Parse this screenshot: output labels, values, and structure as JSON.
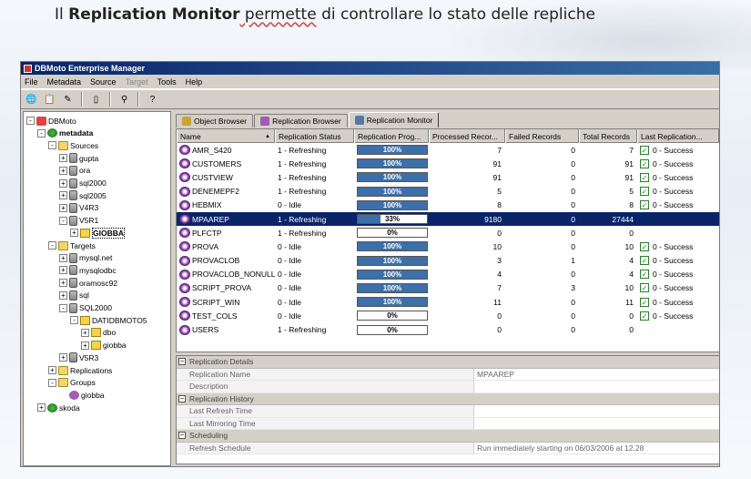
{
  "slide": {
    "prefix": "Il ",
    "bold": "Replication Monitor",
    "middle": " permette",
    "rest": " di controllare lo stato delle repliche"
  },
  "window": {
    "title": "DBMoto Enterprise Manager",
    "menu": [
      "File",
      "Metadata",
      "Source",
      "Target",
      "Tools",
      "Help"
    ]
  },
  "tree": [
    {
      "label": "DBMoto",
      "icon": "dbmoto-icon",
      "level": 0,
      "pm": "-"
    },
    {
      "label": "metadata",
      "icon": "globe-icon",
      "level": 1,
      "pm": "-",
      "bold": true
    },
    {
      "label": "Sources",
      "icon": "folder-icon",
      "level": 2,
      "pm": "-"
    },
    {
      "label": "gupta",
      "icon": "database-icon",
      "level": 3,
      "pm": "+"
    },
    {
      "label": "ora",
      "icon": "database-icon",
      "level": 3,
      "pm": "+"
    },
    {
      "label": "sql2000",
      "icon": "database-icon",
      "level": 3,
      "pm": "+"
    },
    {
      "label": "sql2005",
      "icon": "database-icon",
      "level": 3,
      "pm": "+"
    },
    {
      "label": "V4R3",
      "icon": "database-icon",
      "level": 3,
      "pm": "+"
    },
    {
      "label": "V5R1",
      "icon": "database-icon",
      "level": 3,
      "pm": "-"
    },
    {
      "label": "GIOBBA",
      "icon": "schema-icon",
      "level": 4,
      "pm": "+",
      "selected": true
    },
    {
      "label": "Targets",
      "icon": "folder-icon",
      "level": 2,
      "pm": "-"
    },
    {
      "label": "mysql.net",
      "icon": "database-icon",
      "level": 3,
      "pm": "+"
    },
    {
      "label": "mysqlodbc",
      "icon": "database-icon",
      "level": 3,
      "pm": "+"
    },
    {
      "label": "oramosc92",
      "icon": "database-icon",
      "level": 3,
      "pm": "+"
    },
    {
      "label": "sql",
      "icon": "database-icon",
      "level": 3,
      "pm": "+"
    },
    {
      "label": "SQL2000",
      "icon": "database-icon",
      "level": 3,
      "pm": "-"
    },
    {
      "label": "DATIDBMOTO5",
      "icon": "schema-icon",
      "level": 4,
      "pm": "-"
    },
    {
      "label": "dbo",
      "icon": "schema-icon",
      "level": 5,
      "pm": "+"
    },
    {
      "label": "giobba",
      "icon": "schema-icon",
      "level": 5,
      "pm": "+"
    },
    {
      "label": "V5R3",
      "icon": "database-icon",
      "level": 3,
      "pm": "+"
    },
    {
      "label": "Replications",
      "icon": "folder-icon",
      "level": 2,
      "pm": "+"
    },
    {
      "label": "Groups",
      "icon": "folder-icon",
      "level": 2,
      "pm": "-"
    },
    {
      "label": "giobba",
      "icon": "group-icon",
      "level": 3,
      "pm": ""
    },
    {
      "label": "skoda",
      "icon": "globe-icon",
      "level": 1,
      "pm": "+"
    }
  ],
  "tabs": [
    {
      "label": "Object Browser",
      "icon": "object-browser-icon",
      "active": false
    },
    {
      "label": "Replication Browser",
      "icon": "replication-browser-icon",
      "active": false
    },
    {
      "label": "Replication Monitor",
      "icon": "replication-monitor-icon",
      "active": true
    }
  ],
  "grid": {
    "columns": [
      "Name",
      "Replication Status",
      "Replication  Prog...",
      "Processed Recor...",
      "Failed Records",
      "Total Records",
      "Last  Replication..."
    ],
    "rows": [
      {
        "name": "AMR_S420",
        "status": "1 - Refreshing",
        "progress": "100%",
        "pct": 1.0,
        "processed": "7",
        "failed": "0",
        "total": "7",
        "check": true,
        "last": "0 - Success"
      },
      {
        "name": "CUSTOMERS",
        "status": "1 - Refreshing",
        "progress": "100%",
        "pct": 1.0,
        "processed": "91",
        "failed": "0",
        "total": "91",
        "check": true,
        "last": "0 - Success"
      },
      {
        "name": "CUSTVIEW",
        "status": "1 - Refreshing",
        "progress": "100%",
        "pct": 1.0,
        "processed": "91",
        "failed": "0",
        "total": "91",
        "check": true,
        "last": "0 - Success"
      },
      {
        "name": "DENEMEPF2",
        "status": "1 - Refreshing",
        "progress": "100%",
        "pct": 1.0,
        "processed": "5",
        "failed": "0",
        "total": "5",
        "check": true,
        "last": "0 - Success"
      },
      {
        "name": "HEBMIX",
        "status": "0 - Idle",
        "progress": "100%",
        "pct": 1.0,
        "processed": "8",
        "failed": "0",
        "total": "8",
        "check": true,
        "last": "0 - Success"
      },
      {
        "name": "MPAAREP",
        "status": "1 - Refreshing",
        "progress": "33%",
        "pct": 0.33,
        "processed": "9180",
        "failed": "0",
        "total": "27444",
        "check": false,
        "last": "",
        "selected": true
      },
      {
        "name": "PLFCTP",
        "status": "1 - Refreshing",
        "progress": "0%",
        "pct": 0,
        "processed": "0",
        "failed": "0",
        "total": "0",
        "check": false,
        "last": ""
      },
      {
        "name": "PROVA",
        "status": "0 - Idle",
        "progress": "100%",
        "pct": 1.0,
        "processed": "10",
        "failed": "0",
        "total": "10",
        "check": true,
        "last": "0 - Success"
      },
      {
        "name": "PROVACLOB",
        "status": "0 - Idle",
        "progress": "100%",
        "pct": 1.0,
        "processed": "3",
        "failed": "1",
        "total": "4",
        "check": true,
        "last": "0 - Success"
      },
      {
        "name": "PROVACLOB_NONULL",
        "status": "0 - Idle",
        "progress": "100%",
        "pct": 1.0,
        "processed": "4",
        "failed": "0",
        "total": "4",
        "check": true,
        "last": "0 - Success"
      },
      {
        "name": "SCRIPT_PROVA",
        "status": "0 - Idle",
        "progress": "100%",
        "pct": 1.0,
        "processed": "7",
        "failed": "3",
        "total": "10",
        "check": true,
        "last": "0 - Success"
      },
      {
        "name": "SCRIPT_WIN",
        "status": "0 - Idle",
        "progress": "100%",
        "pct": 1.0,
        "processed": "11",
        "failed": "0",
        "total": "11",
        "check": true,
        "last": "0 - Success"
      },
      {
        "name": "TEST_COLS",
        "status": "0 - Idle",
        "progress": "0%",
        "pct": 0,
        "processed": "0",
        "failed": "0",
        "total": "0",
        "check": true,
        "last": "0 - Success"
      },
      {
        "name": "USERS",
        "status": "1 - Refreshing",
        "progress": "0%",
        "pct": 0,
        "processed": "0",
        "failed": "0",
        "total": "0",
        "check": false,
        "last": ""
      }
    ]
  },
  "details": [
    {
      "section": "Replication Details",
      "rows": [
        {
          "key": "Replication Name",
          "value": "MPAAREP"
        },
        {
          "key": "Description",
          "value": ""
        }
      ]
    },
    {
      "section": "Replication History",
      "rows": [
        {
          "key": "Last Refresh Time",
          "value": ""
        },
        {
          "key": "Last Mirroring Time",
          "value": ""
        }
      ]
    },
    {
      "section": "Scheduling",
      "rows": [
        {
          "key": "Refresh Schedule",
          "value": "Run immediately starting on 06/03/2006 at 12.28"
        }
      ]
    }
  ],
  "colors": {
    "accent": "#0a246a",
    "progress": "#3d6fa8",
    "success": "#2a7a2a"
  }
}
